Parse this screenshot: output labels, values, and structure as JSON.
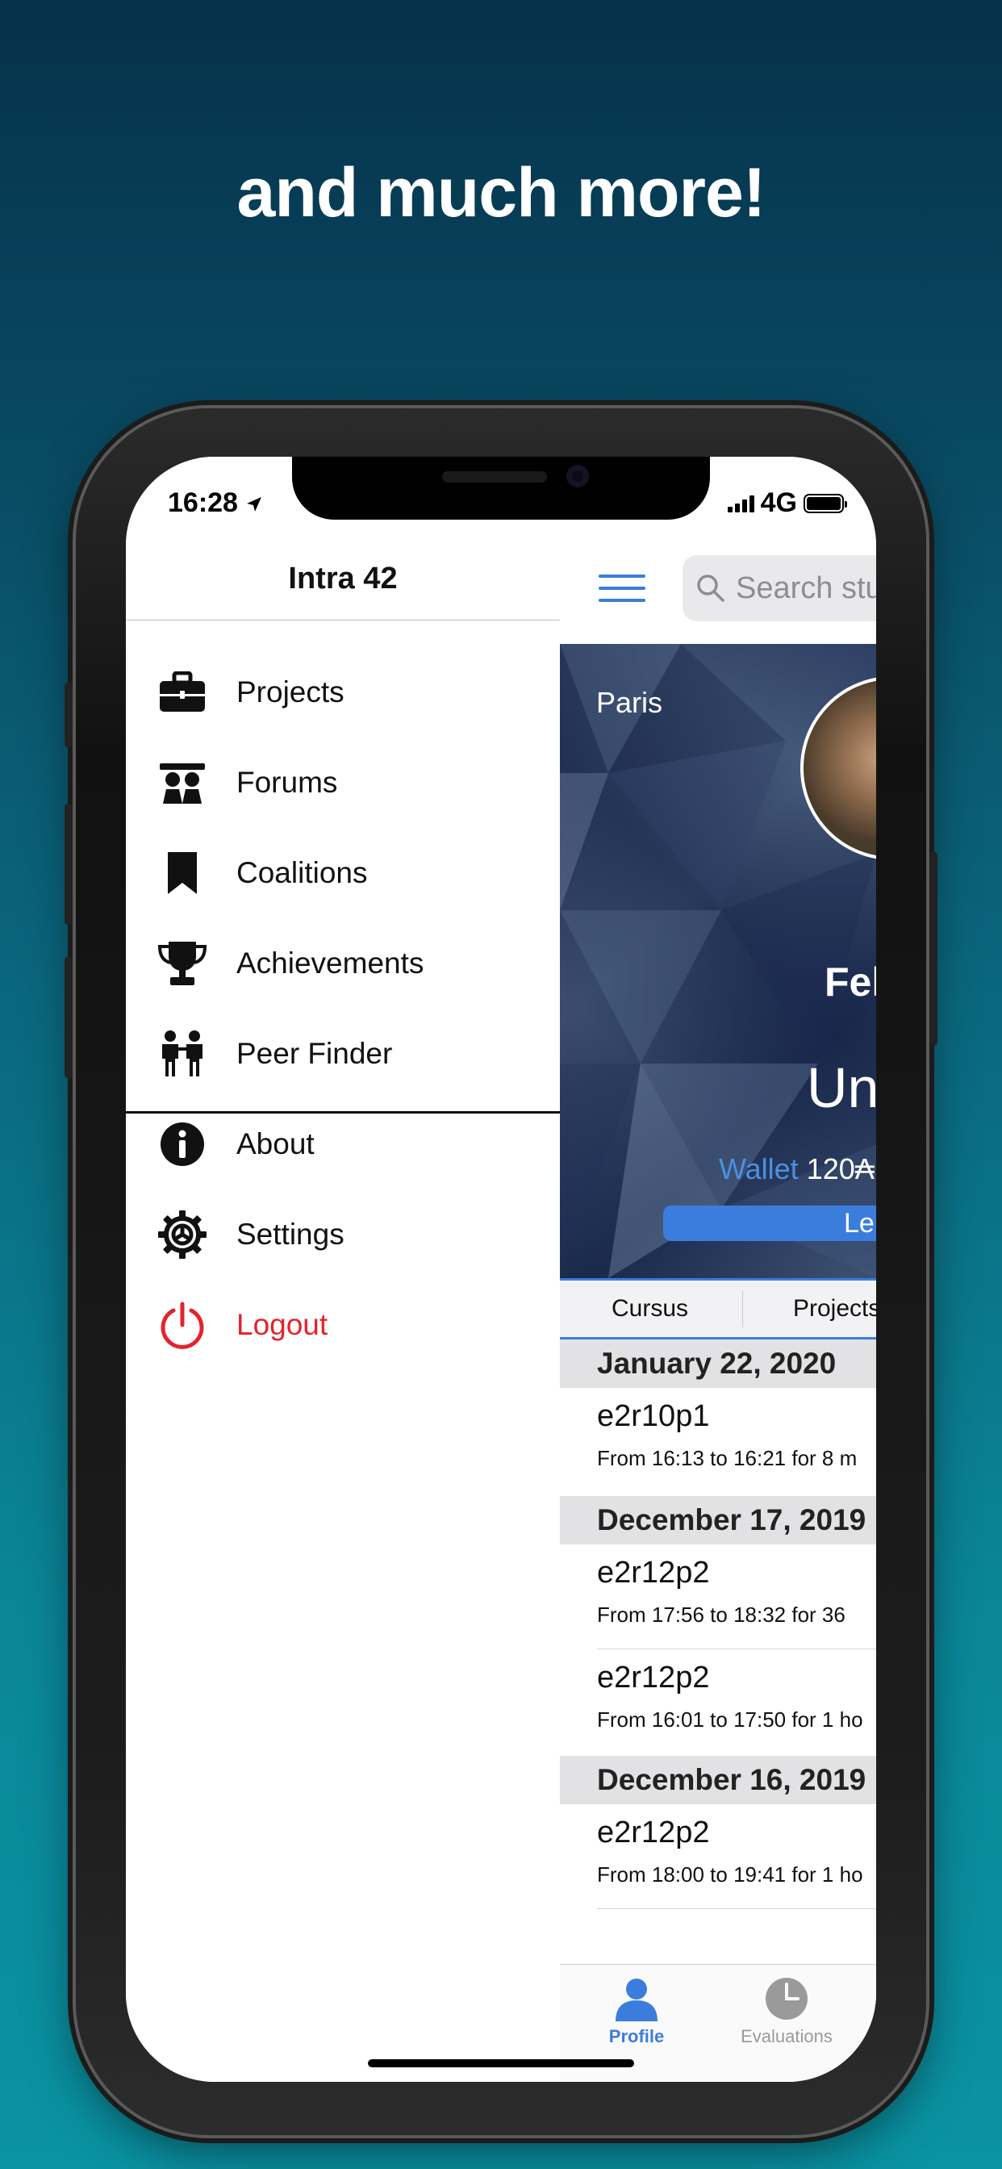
{
  "headline": "and much more!",
  "status_bar": {
    "time": "16:28",
    "network": "4G"
  },
  "drawer": {
    "title": "Intra 42",
    "items": [
      {
        "label": "Projects",
        "icon": "briefcase-icon"
      },
      {
        "label": "Forums",
        "icon": "forum-icon"
      },
      {
        "label": "Coalitions",
        "icon": "bookmark-icon"
      },
      {
        "label": "Achievements",
        "icon": "trophy-icon"
      },
      {
        "label": "Peer Finder",
        "icon": "peer-finder-icon"
      },
      {
        "label": "About",
        "icon": "info-icon"
      },
      {
        "label": "Settings",
        "icon": "gear-icon"
      },
      {
        "label": "Logout",
        "icon": "power-icon"
      }
    ]
  },
  "content": {
    "search_placeholder": "Search stu",
    "profile": {
      "city": "Paris",
      "name": "Fel",
      "status": "Un",
      "wallet_label": "Wallet",
      "wallet_value": "120₳",
      "level_label": "Le"
    },
    "tabs": [
      "Cursus",
      "Projects"
    ],
    "log_sections": [
      {
        "date": "January 22, 2020",
        "entries": [
          {
            "host": "e2r10p1",
            "detail": "From 16:13 to 16:21 for 8 m"
          }
        ]
      },
      {
        "date": "December 17, 2019",
        "entries": [
          {
            "host": "e2r12p2",
            "detail": "From 17:56 to 18:32 for 36"
          },
          {
            "host": "e2r12p2",
            "detail": "From 16:01 to 17:50 for 1 ho"
          }
        ]
      },
      {
        "date": "December 16, 2019",
        "entries": [
          {
            "host": "e2r12p2",
            "detail": "From 18:00 to 19:41 for 1 ho"
          }
        ]
      }
    ],
    "tabbar": [
      {
        "label": "Profile",
        "icon": "profile-icon",
        "active": true
      },
      {
        "label": "Evaluations",
        "icon": "clock-icon",
        "active": false
      }
    ]
  },
  "colors": {
    "accent": "#3b7ddd",
    "logout": "#e3242b",
    "tab_inactive": "#9a9a9a"
  }
}
